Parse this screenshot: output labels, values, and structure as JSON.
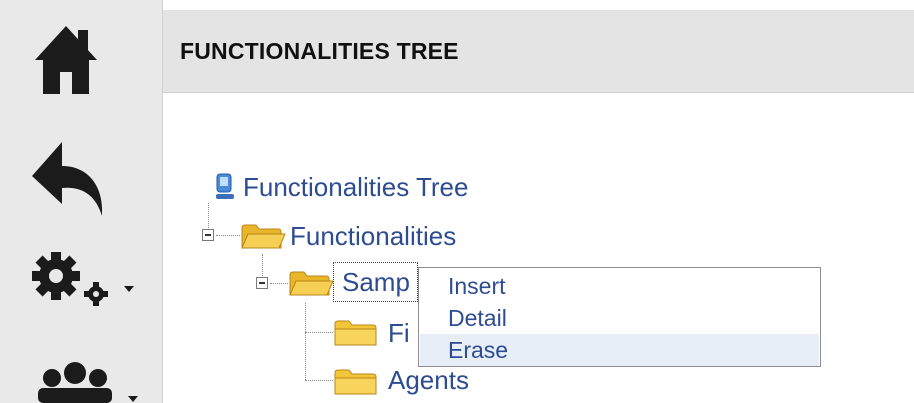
{
  "sidebar": {
    "icons": [
      "home-icon",
      "back-arrow-icon",
      "settings-gears-icon",
      "users-icon"
    ]
  },
  "header": {
    "title": "FUNCTIONALITIES TREE"
  },
  "tree": {
    "root_label": "Functionalities Tree",
    "functionalities_label": "Functionalities",
    "sample_label": "Samp",
    "child_partial_label": "Fi",
    "agents_label": "Agents"
  },
  "context_menu": {
    "items": [
      {
        "label": "Insert"
      },
      {
        "label": "Detail"
      },
      {
        "label": "Erase",
        "highlighted": true
      }
    ]
  },
  "colors": {
    "link_text": "#2e4c92",
    "folder": "#f3c53a",
    "sidebar_bg": "#e9e9e9",
    "header_bg": "#e4e4e4"
  }
}
